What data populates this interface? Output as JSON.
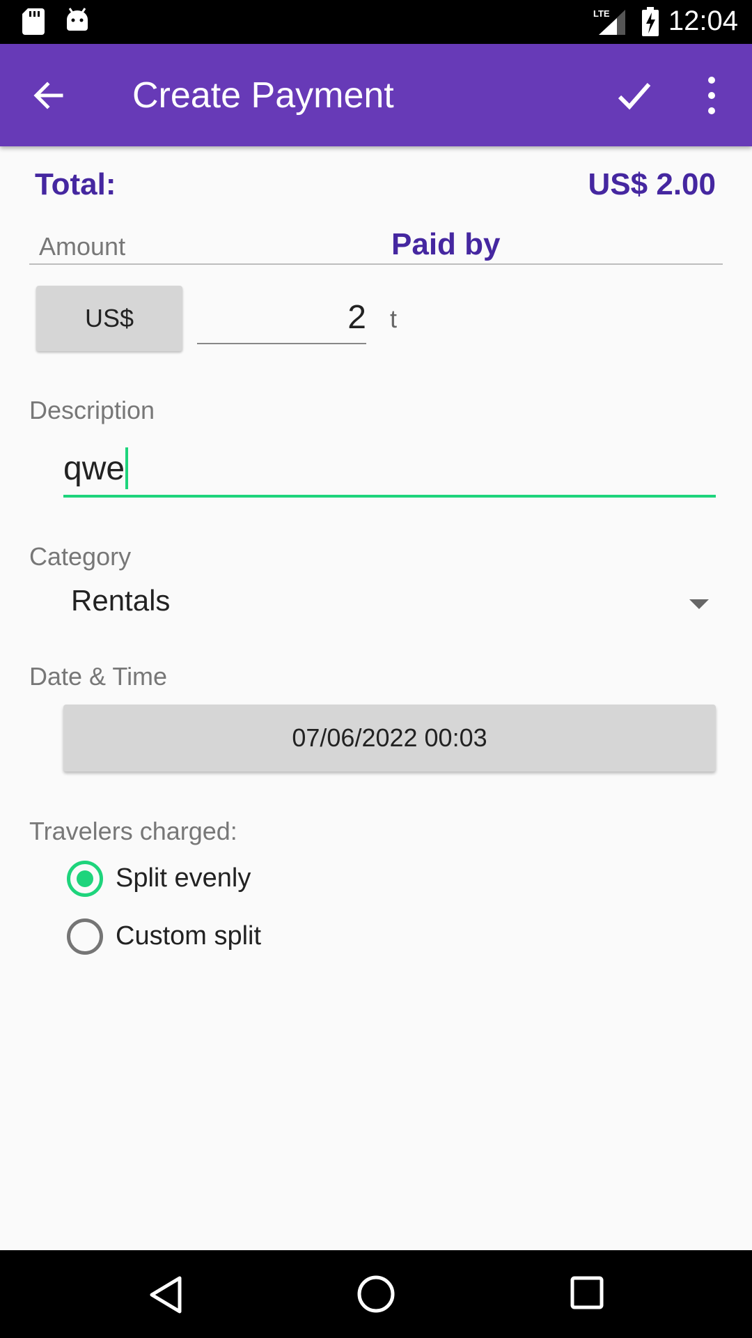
{
  "status_bar": {
    "time": "12:04",
    "network": "LTE",
    "icons": [
      "sd-card-icon",
      "android-icon",
      "lte-signal-icon",
      "battery-charging-icon"
    ]
  },
  "toolbar": {
    "title": "Create Payment",
    "icons": [
      "back-arrow-icon",
      "checkmark-icon",
      "more-vertical-icon"
    ],
    "color": "#673ab7"
  },
  "summary": {
    "total_label": "Total:",
    "total_value": "US$ 2.00",
    "accent_color": "#4527a0"
  },
  "amount": {
    "label": "Amount",
    "paid_by_label": "Paid by",
    "currency_button": "US$",
    "value": "2",
    "suffix": "t"
  },
  "description": {
    "label": "Description",
    "value": "qwe",
    "focus_color": "#1ed47c"
  },
  "category": {
    "label": "Category",
    "selected": "Rentals"
  },
  "datetime": {
    "label": "Date & Time",
    "value": "07/06/2022 00:03"
  },
  "travelers": {
    "label": "Travelers charged:",
    "options": [
      {
        "label": "Split evenly",
        "selected": true
      },
      {
        "label": "Custom split",
        "selected": false
      }
    ]
  },
  "nav_bar": {
    "icons": [
      "nav-back-icon",
      "nav-home-icon",
      "nav-recents-icon"
    ]
  }
}
